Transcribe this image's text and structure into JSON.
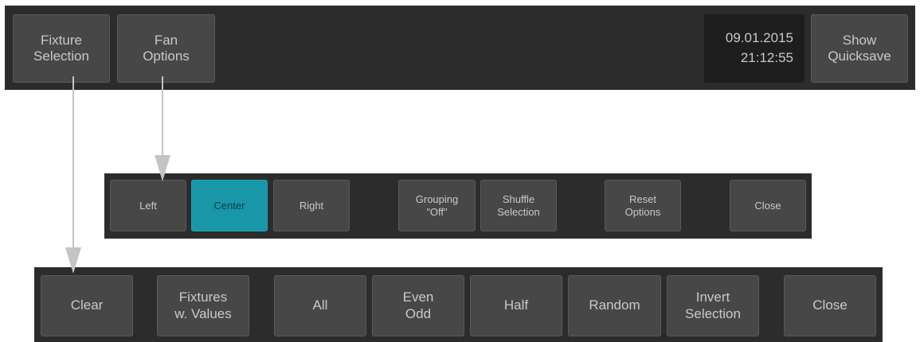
{
  "top_bar": {
    "fixture_selection": "Fixture\nSelection",
    "fan_options": "Fan\nOptions",
    "date": "09.01.2015",
    "time": "21:12:55",
    "show_quicksave": "Show\nQuicksave"
  },
  "fan_panel": {
    "left": "Left",
    "center": "Center",
    "right": "Right",
    "grouping": "Grouping\n\"Off\"",
    "shuffle": "Shuffle\nSelection",
    "reset": "Reset\nOptions",
    "close": "Close"
  },
  "selection_panel": {
    "clear": "Clear",
    "fixtures_values": "Fixtures\nw. Values",
    "all": "All",
    "even_odd": "Even\nOdd",
    "half": "Half",
    "random": "Random",
    "invert": "Invert\nSelection",
    "close": "Close"
  },
  "colors": {
    "bar": "#2c2c2c",
    "button": "#474747",
    "active": "#1797a8",
    "arrow": "#c4c4c4"
  }
}
